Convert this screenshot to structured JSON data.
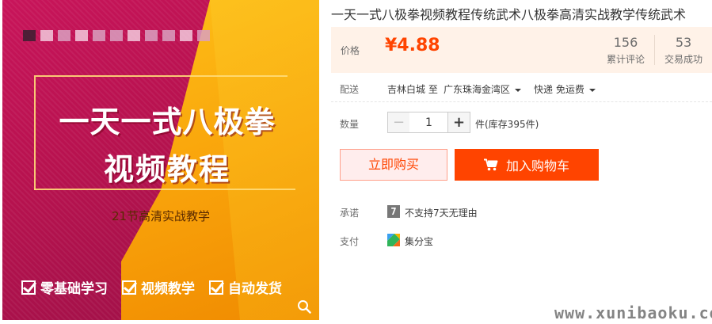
{
  "image": {
    "title_line1": "一天一式八极拳",
    "title_line2": "视频教程",
    "subtitle": "21节高清实战教学",
    "features": [
      "零基础学习",
      "视频教学",
      "自动发货"
    ]
  },
  "product": {
    "title": "一天一式八极拳视频教程传统武术八极拳高清实战教学传统武术"
  },
  "price": {
    "label": "价格",
    "value": "¥4.88",
    "reviews_count": "156",
    "reviews_label": "累计评论",
    "deals_count": "53",
    "deals_label": "交易成功"
  },
  "shipping": {
    "label": "配送",
    "from": "吉林白城 至",
    "to": "广东珠海金湾区",
    "method": "快递 免运费"
  },
  "quantity": {
    "label": "数量",
    "value": "1",
    "minus": "−",
    "plus": "+",
    "stock": "件(库存395件)"
  },
  "actions": {
    "buy_now": "立即购买",
    "add_to_cart": "加入购物车"
  },
  "promise": {
    "label": "承诺",
    "icon_text": "7",
    "text": "不支持7天无理由"
  },
  "payment": {
    "label": "支付",
    "text": "集分宝"
  },
  "watermark": "www.xunibaoku.com",
  "colors": {
    "accent": "#ff4400",
    "price_bg": "#fff2e8",
    "image_magenta": "#c8145a",
    "image_orange": "#f9a40b"
  }
}
